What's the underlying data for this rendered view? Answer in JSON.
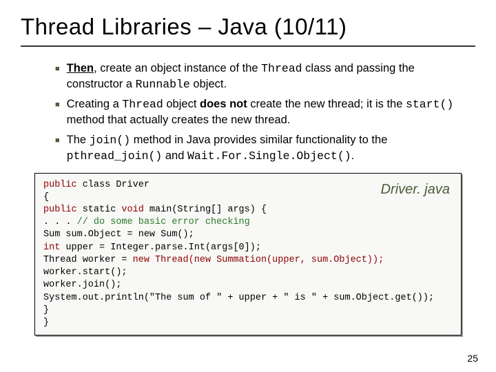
{
  "title": "Thread Libraries – Java (10/11)",
  "bullets": {
    "b1": {
      "then": "Then",
      "t1": ", create an object instance of the ",
      "thread": "Thread",
      "t2": " class and passing the constructor a ",
      "runnable": "Runnable",
      "t3": " object."
    },
    "b2": {
      "t1": "Creating a ",
      "thread": "Thread",
      "t2": " object ",
      "doesnot": "does not",
      "t3": " create the new thread; it is the ",
      "start": "start()",
      "t4": " method that actually creates the new thread."
    },
    "b3": {
      "t1": "The ",
      "join": "join()",
      "t2": " method in Java provides similar functionality to the ",
      "pjoin": "pthread_join()",
      "t3": " and ",
      "wfso": "Wait.For.Single.Object()",
      "t4": "."
    }
  },
  "code": {
    "label": "Driver. java",
    "l1a": "public",
    "l1b": " class Driver",
    "l2": "{",
    "l3a": "  public",
    "l3b": " static ",
    "l3c": "void",
    "l3d": " main(String[] args) {",
    "l4a": "    . . . ",
    "l4b": "// do some basic error checking",
    "l5": "    Sum sum.Object = new Sum();",
    "l6a": "    int",
    "l6b": " upper = Integer.parse.Int(args[0]);",
    "blank": " ",
    "l7a": "    Thread worker = ",
    "l7b": "new Thread(new Summation(upper, sum.Object));",
    "l8": "    worker.start();",
    "l9": "    worker.join();",
    "l10": "    System.out.println(\"The sum of \" + upper + \" is \" + sum.Object.get());",
    "l11": "  }",
    "l12": "}"
  },
  "pagenum": "25"
}
